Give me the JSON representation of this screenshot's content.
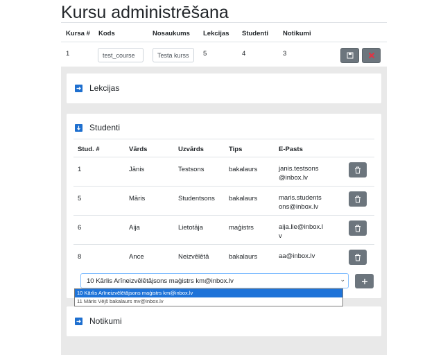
{
  "page": {
    "title": "Kursu administrēšana"
  },
  "course_table": {
    "headers": [
      "Kursa #",
      "Kods",
      "Nosaukums",
      "Lekcijas",
      "Studenti",
      "Notikumi"
    ],
    "row": {
      "id": "1",
      "code": "test_course",
      "name": "Testa kurss",
      "lectures": "5",
      "students": "4",
      "events": "3"
    }
  },
  "sections": {
    "lectures": {
      "label": "Lekcijas"
    },
    "students": {
      "label": "Studenti"
    },
    "events": {
      "label": "Notikumi"
    }
  },
  "students_table": {
    "headers": [
      "Stud. #",
      "Vārds",
      "Uzvārds",
      "Tips",
      "E-Pasts"
    ],
    "rows": [
      {
        "id": "1",
        "first": "Jānis",
        "last": "Testsons",
        "type": "bakalaurs",
        "email": "janis.testsons@inbox.lv"
      },
      {
        "id": "5",
        "first": "Māris",
        "last": "Studentsons",
        "type": "bakalaurs",
        "email": "maris.studentsons@inbox.lv"
      },
      {
        "id": "6",
        "first": "Aija",
        "last": "Lietotāja",
        "type": "maģistrs",
        "email": "aija.lie@inbox.lv"
      },
      {
        "id": "8",
        "first": "Ance",
        "last": "Neizvēlētā",
        "type": "bakalaurs",
        "email": "aa@inbox.lv"
      }
    ]
  },
  "student_select": {
    "value": "10 Kārlis Arīneizvēlētājsons maģistrs km@inbox.lv",
    "options": [
      "10 Kārlis Arīneizvēlētājsons maģistrs km@inbox.lv",
      "11 Māris Vējš bakalaurs mv@inbox.lv"
    ]
  },
  "colors": {
    "toggle": "#1e6fcf",
    "button": "#6c757d",
    "delete": "#dc3545",
    "panel": "#e9e9e9"
  },
  "icons": {
    "save": "save-icon",
    "delete": "x-icon",
    "trash": "trash-icon",
    "add": "plus-icon",
    "expand": "arrow-right-icon",
    "collapse": "arrow-down-icon"
  }
}
